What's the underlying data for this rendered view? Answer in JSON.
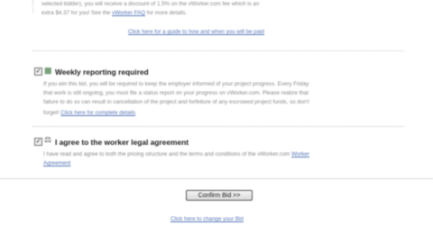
{
  "discount": {
    "line1": "selected bidder), you will receive a discount of 1.5% on the vWorker.com fee which is an",
    "line2": "extra $4.37 for you!  See the",
    "faq_link": "vWorker FAQ",
    "line2_end": "for more details.",
    "help_link": "Click here for a guide to how and when you will be paid"
  },
  "reporting": {
    "checked": "✓",
    "title": "Weekly reporting required",
    "body1": "If you win this bid, you will be required to keep the employer informed of your project progress. Every Friday",
    "body2": "that work is still ongoing, you must file a status report on your progress on vWorker.com. Please realize that",
    "body3": "failure to do so can result in cancellation of the project and forfeiture of any escrowed project funds, so don't",
    "body4": "forget!",
    "details_link": "Click here for complete details"
  },
  "agreement": {
    "checked": "✓",
    "title": "I agree to the worker legal agreement",
    "body1": "I have read and agree to both the pricing structure and the terms and conditions of the vWorker.com",
    "link_part1": "Worker",
    "link_part2": "Agreement"
  },
  "actions": {
    "confirm_label": "Confirm Bid >>",
    "change_link": "Click here to change your Bid"
  }
}
